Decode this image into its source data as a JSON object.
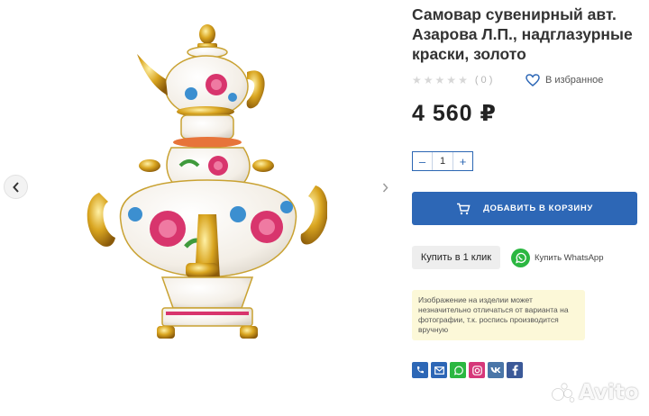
{
  "product": {
    "title": "Самовар сувенирный авт. Азарова Л.П., надглазурные краски, золото",
    "rating_count": "( 0 )",
    "favorite_label": "В избранное",
    "price": "4 560 ₽",
    "quantity": "1",
    "minus": "–",
    "plus": "+",
    "add_to_cart": "ДОБАВИТЬ В КОРЗИНУ",
    "buy_one_click": "Купить в 1 клик",
    "whatsapp_label": "Купить WhatsApp",
    "notice": "Изображение на изделии может незначительно отличаться от варианта на фотографии, т.к. роспись производится вручную"
  },
  "socials": [
    {
      "name": "phone",
      "color": "#2d67b6"
    },
    {
      "name": "email",
      "color": "#2d67b6"
    },
    {
      "name": "whatsapp",
      "color": "#2bb741"
    },
    {
      "name": "instagram",
      "color": "#d6387a"
    },
    {
      "name": "vk",
      "color": "#4a76a8"
    },
    {
      "name": "facebook",
      "color": "#3b5998"
    }
  ],
  "watermark": "Avito",
  "colors": {
    "accent": "#2d67b6",
    "notice_bg": "#fcf8d8",
    "whatsapp": "#2bb741"
  }
}
